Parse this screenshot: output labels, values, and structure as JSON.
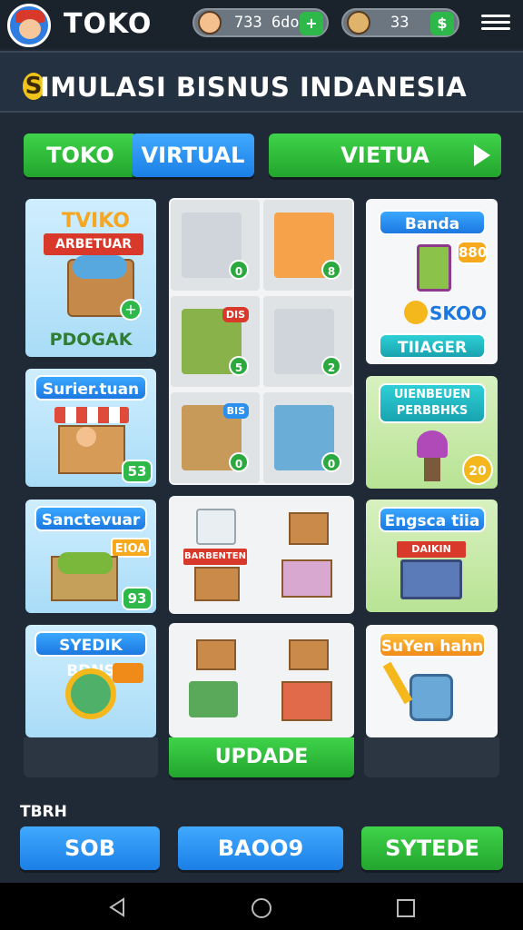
{
  "topbar": {
    "title": "TOKO",
    "currency1": "733 6do",
    "currency2": "33"
  },
  "header": {
    "coin_letter": "S",
    "title": "IMULASI BISNUS INDANESIA"
  },
  "tabs": {
    "tab1": "TOKO",
    "tab2": "VIRTUAL",
    "tab3": "VIETUA"
  },
  "left_cards": [
    {
      "top": "TVIKO",
      "banner": "ARBETUAR",
      "footer": "PDOGAK"
    },
    {
      "tag": "Surier.tuan",
      "badge": "53"
    },
    {
      "tag": "Sanctevuar",
      "badge": "93",
      "sign": "EIOA"
    },
    {
      "tag": "SYEDIK BDNS"
    }
  ],
  "middle": {
    "tile_badges": [
      "0",
      "8",
      "5",
      "2",
      "0",
      "0"
    ],
    "tile_labels": [
      "",
      "",
      "DIS",
      "",
      "BIS",
      ""
    ],
    "update_button": "UPDADE",
    "shop_sign": "BARBENTEN"
  },
  "right_cards": [
    {
      "tag1": "Banda",
      "badge": "880",
      "tag2": "SKOO",
      "tag3": "TIIAGER"
    },
    {
      "tag": "UIENBEUEN PERBBHKS",
      "coin": "20"
    },
    {
      "tag": "Engsca tiia",
      "sign": "DAIKIN"
    },
    {
      "tag": "SuYen hahn"
    }
  ],
  "bottom": {
    "label": "TBRH",
    "btn1": "SOB",
    "btn2": "BAOO9",
    "btn3": "SYTEDE"
  },
  "nav": {
    "back_icon": "back-triangle-icon",
    "home_icon": "home-circle-icon",
    "recents_icon": "recents-square-icon"
  },
  "colors": {
    "bg": "#1f2a36",
    "green": "#2eb84a",
    "blue": "#2b8ff0"
  }
}
